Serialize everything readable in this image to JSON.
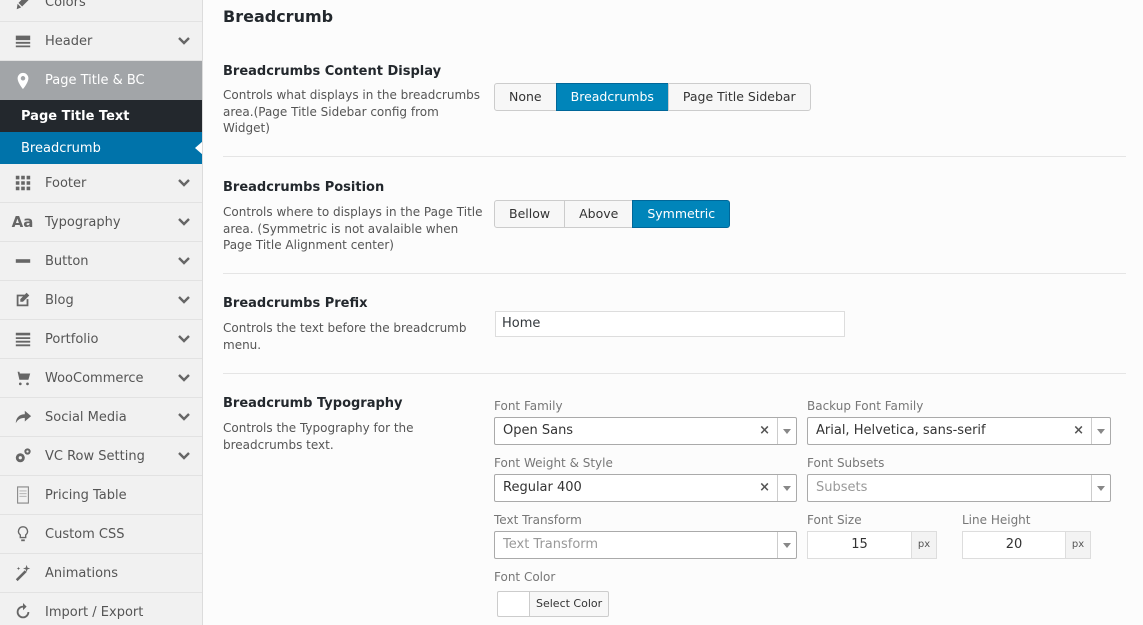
{
  "sidebar": {
    "items": [
      {
        "label": "Colors",
        "icon": "brush-icon"
      },
      {
        "label": "Header",
        "icon": "header-icon"
      },
      {
        "label": "Page Title & BC",
        "icon": "location-pin-icon"
      },
      {
        "label": "Footer",
        "icon": "grid-icon"
      },
      {
        "label": "Typography",
        "icon": "typography-icon"
      },
      {
        "label": "Button",
        "icon": "minus-icon"
      },
      {
        "label": "Blog",
        "icon": "edit-icon"
      },
      {
        "label": "Portfolio",
        "icon": "list-icon"
      },
      {
        "label": "WooCommerce",
        "icon": "cart-icon"
      },
      {
        "label": "Social Media",
        "icon": "share-icon"
      },
      {
        "label": "VC Row Setting",
        "icon": "gears-icon"
      },
      {
        "label": "Pricing Table",
        "icon": "document-icon"
      },
      {
        "label": "Custom CSS",
        "icon": "lightbulb-icon"
      },
      {
        "label": "Animations",
        "icon": "magic-wand-icon"
      },
      {
        "label": "Import / Export",
        "icon": "refresh-icon"
      }
    ],
    "sub_items": [
      {
        "label": "Page Title Text"
      },
      {
        "label": "Breadcrumb"
      }
    ]
  },
  "main": {
    "title": "Breadcrumb",
    "content_display": {
      "title": "Breadcrumbs Content Display",
      "desc": "Controls what displays in the breadcrumbs area.(Page Title Sidebar config from Widget)",
      "options": [
        "None",
        "Breadcrumbs",
        "Page Title Sidebar"
      ],
      "selected": "Breadcrumbs"
    },
    "position": {
      "title": "Breadcrumbs Position",
      "desc": "Controls where to displays in the Page Title area. (Symmetric is not avalaible when Page Title Alignment center)",
      "options": [
        "Bellow",
        "Above",
        "Symmetric"
      ],
      "selected": "Symmetric"
    },
    "prefix": {
      "title": "Breadcrumbs Prefix",
      "desc": "Controls the text before the breadcrumb menu.",
      "value": "Home"
    },
    "typography": {
      "title": "Breadcrumb Typography",
      "desc": "Controls the Typography for the breadcrumbs text.",
      "font_family_label": "Font Family",
      "font_family_value": "Open Sans",
      "backup_font_label": "Backup Font Family",
      "backup_font_value": "Arial, Helvetica, sans-serif",
      "weight_label": "Font Weight & Style",
      "weight_value": "Regular 400",
      "subsets_label": "Font Subsets",
      "subsets_placeholder": "Subsets",
      "transform_label": "Text Transform",
      "transform_placeholder": "Text Transform",
      "size_label": "Font Size",
      "size_value": "15",
      "size_unit": "px",
      "line_height_label": "Line Height",
      "line_height_value": "20",
      "line_height_unit": "px",
      "color_label": "Font Color",
      "color_button": "Select Color"
    }
  },
  "colors": {
    "active_blue": "#0085ba",
    "current_sub_bg": "#0073aa",
    "dark_sub_bg": "#23282d",
    "active_item_bg": "#a2a5a8"
  }
}
